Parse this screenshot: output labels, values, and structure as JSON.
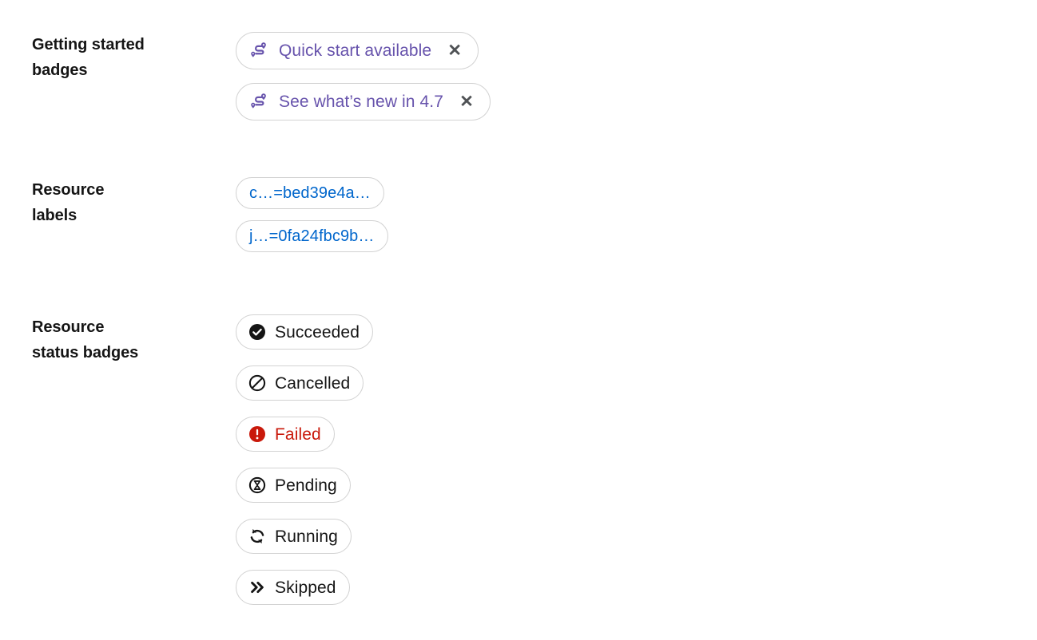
{
  "sections": [
    {
      "id": "getting-started",
      "label": "Getting started\nbadges",
      "badges": [
        {
          "text": "Quick start available",
          "icon": "quick-start-route-icon",
          "color": "#6753ac",
          "dismissible": true,
          "close_label": "✕"
        },
        {
          "text": "See what’s new in 4.7",
          "icon": "quick-start-route-icon",
          "color": "#6753ac",
          "dismissible": true,
          "close_label": "✕"
        }
      ]
    },
    {
      "id": "resource-labels",
      "label": "Resource\nlabels",
      "badges": [
        {
          "text": "c…=bed39e4a…",
          "icon": "none",
          "color": "#0066cc",
          "dismissible": false
        },
        {
          "text": "j…=0fa24fbc9b…",
          "icon": "none",
          "color": "#0066cc",
          "dismissible": false
        }
      ]
    },
    {
      "id": "status-badges",
      "label": "Resource\nstatus badges",
      "badges": [
        {
          "text": "Succeeded",
          "icon": "check-circle-filled-icon",
          "color": "#151515",
          "variant": "default"
        },
        {
          "text": "Cancelled",
          "icon": "ban-icon",
          "color": "#151515",
          "variant": "default"
        },
        {
          "text": "Failed",
          "icon": "exclamation-circle-filled-icon",
          "color": "#c9190b",
          "variant": "danger"
        },
        {
          "text": "Pending",
          "icon": "hourglass-circle-icon",
          "color": "#151515",
          "variant": "default"
        },
        {
          "text": "Running",
          "icon": "sync-alt-icon",
          "color": "#151515",
          "variant": "default"
        },
        {
          "text": "Skipped",
          "icon": "angle-double-right-icon",
          "color": "#151515",
          "variant": "default"
        }
      ]
    }
  ],
  "colors": {
    "purple": "#6753ac",
    "blue": "#0066cc",
    "red": "#c9190b",
    "text": "#151515",
    "border": "#d2d2d2",
    "close": "#4f5255",
    "background": "#ffffff"
  }
}
